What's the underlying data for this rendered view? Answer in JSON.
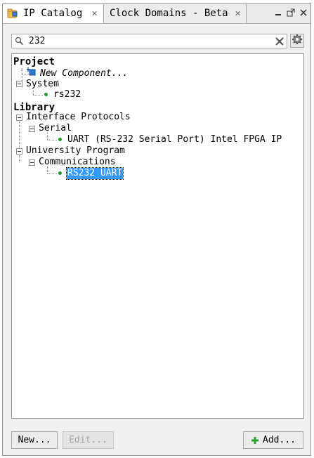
{
  "tabs": [
    {
      "label": "IP Catalog",
      "active": true
    },
    {
      "label": "Clock Domains - Beta",
      "active": false
    }
  ],
  "search": {
    "value": "232"
  },
  "tree": {
    "project_header": "Project",
    "new_component": "New Component...",
    "system": "System",
    "system_child": "rs232",
    "library_header": "Library",
    "interface_protocols": "Interface Protocols",
    "serial": "Serial",
    "uart_item": "UART (RS-232 Serial Port) Intel FPGA IP",
    "university_program": "University Program",
    "communications": "Communications",
    "rs232_uart": "RS232 UART"
  },
  "buttons": {
    "new": "New...",
    "edit": "Edit...",
    "add": "Add..."
  },
  "colors": {
    "selection": "#3399ff",
    "dot": "#1a9a2a",
    "add_plus": "#2e9e2e"
  }
}
